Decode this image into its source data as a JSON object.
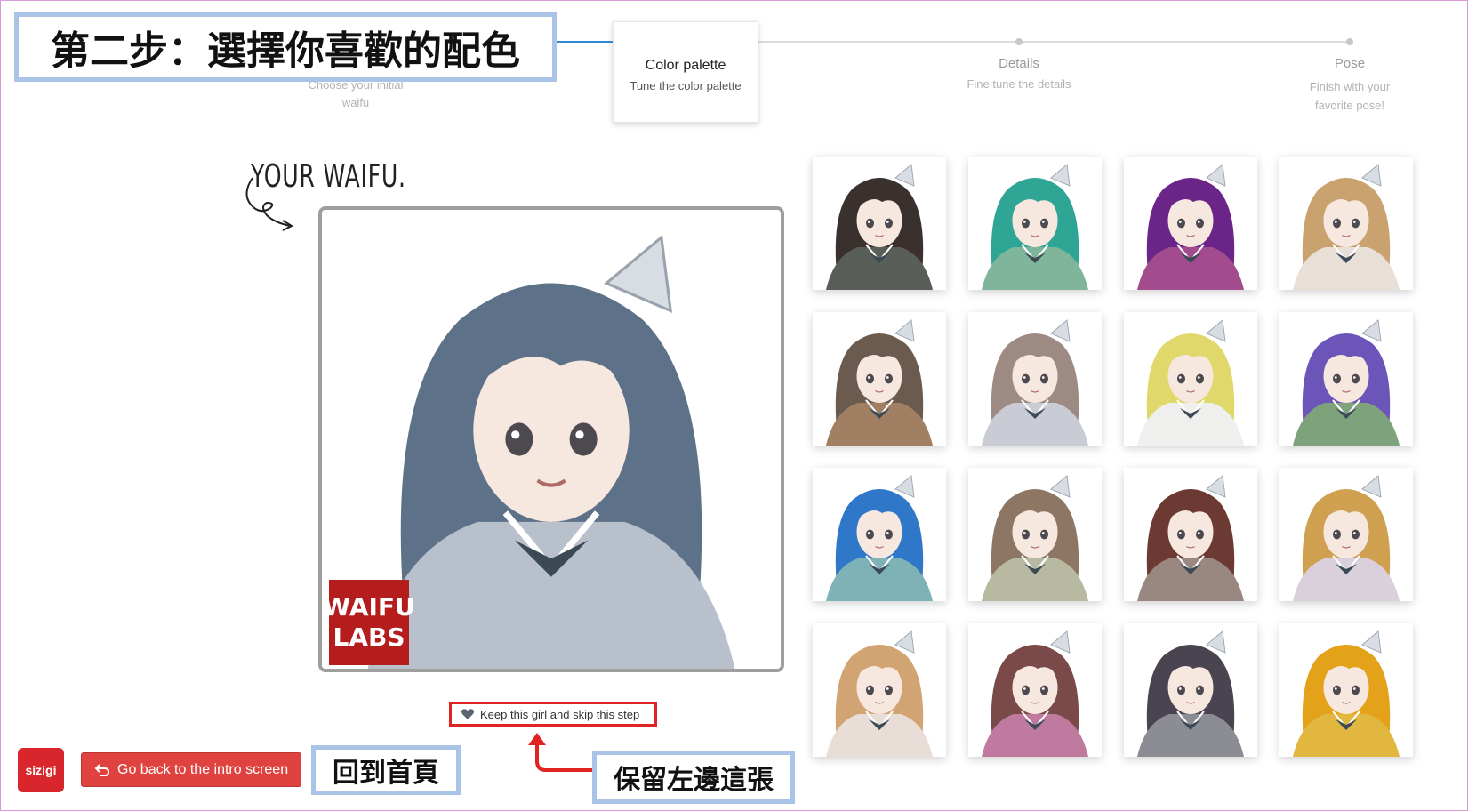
{
  "annotations": {
    "step_banner": "第二步：選擇你喜歡的配色",
    "home_banner": "回到首頁",
    "keep_banner": "保留左邊這張"
  },
  "steps": [
    {
      "title": "",
      "subtitle": "Choose your initial waifu",
      "state": "done"
    },
    {
      "title": "Color palette",
      "subtitle": "Tune the color palette",
      "state": "active"
    },
    {
      "title": "Details",
      "subtitle": "Fine tune the details",
      "state": "pending"
    },
    {
      "title": "Pose",
      "subtitle": "Finish with your favorite pose!",
      "state": "pending"
    }
  ],
  "label": "YOUR WAIFU.",
  "stamp": {
    "line1": "WAIFU",
    "line2": "LABS"
  },
  "keep_button": "Keep this girl and skip this step",
  "back_button": "Go back to the intro screen",
  "logo_text": "sizigi",
  "colors": {
    "accent": "#2f8bd8",
    "danger": "#e0433f",
    "highlight": "#e02424",
    "banner_border": "#a9c4e6"
  },
  "main_portrait": {
    "hair": "#5d7189",
    "outfit": "#b8c0cc"
  },
  "options": [
    {
      "hair": "#3a302d",
      "outfit": "#5a5e58"
    },
    {
      "hair": "#2fa596",
      "outfit": "#7fb59a"
    },
    {
      "hair": "#6b2488",
      "outfit": "#a34b8f"
    },
    {
      "hair": "#c9a270",
      "outfit": "#e8e0d6"
    },
    {
      "hair": "#6b5a4e",
      "outfit": "#a07f63"
    },
    {
      "hair": "#9c8a83",
      "outfit": "#c9ccd4"
    },
    {
      "hair": "#e1d86b",
      "outfit": "#efefee"
    },
    {
      "hair": "#6c55b8",
      "outfit": "#7ea27b"
    },
    {
      "hair": "#2f78c9",
      "outfit": "#7fb2b6"
    },
    {
      "hair": "#8d7764",
      "outfit": "#b8b9a1"
    },
    {
      "hair": "#6d3a33",
      "outfit": "#9a8880"
    },
    {
      "hair": "#cfa04f",
      "outfit": "#d9d0dc"
    },
    {
      "hair": "#d3a473",
      "outfit": "#e8ddd7"
    },
    {
      "hair": "#7a4a48",
      "outfit": "#c07aa0"
    },
    {
      "hair": "#4a4450",
      "outfit": "#8c8c94"
    },
    {
      "hair": "#e3a21a",
      "outfit": "#e1b73f"
    }
  ]
}
